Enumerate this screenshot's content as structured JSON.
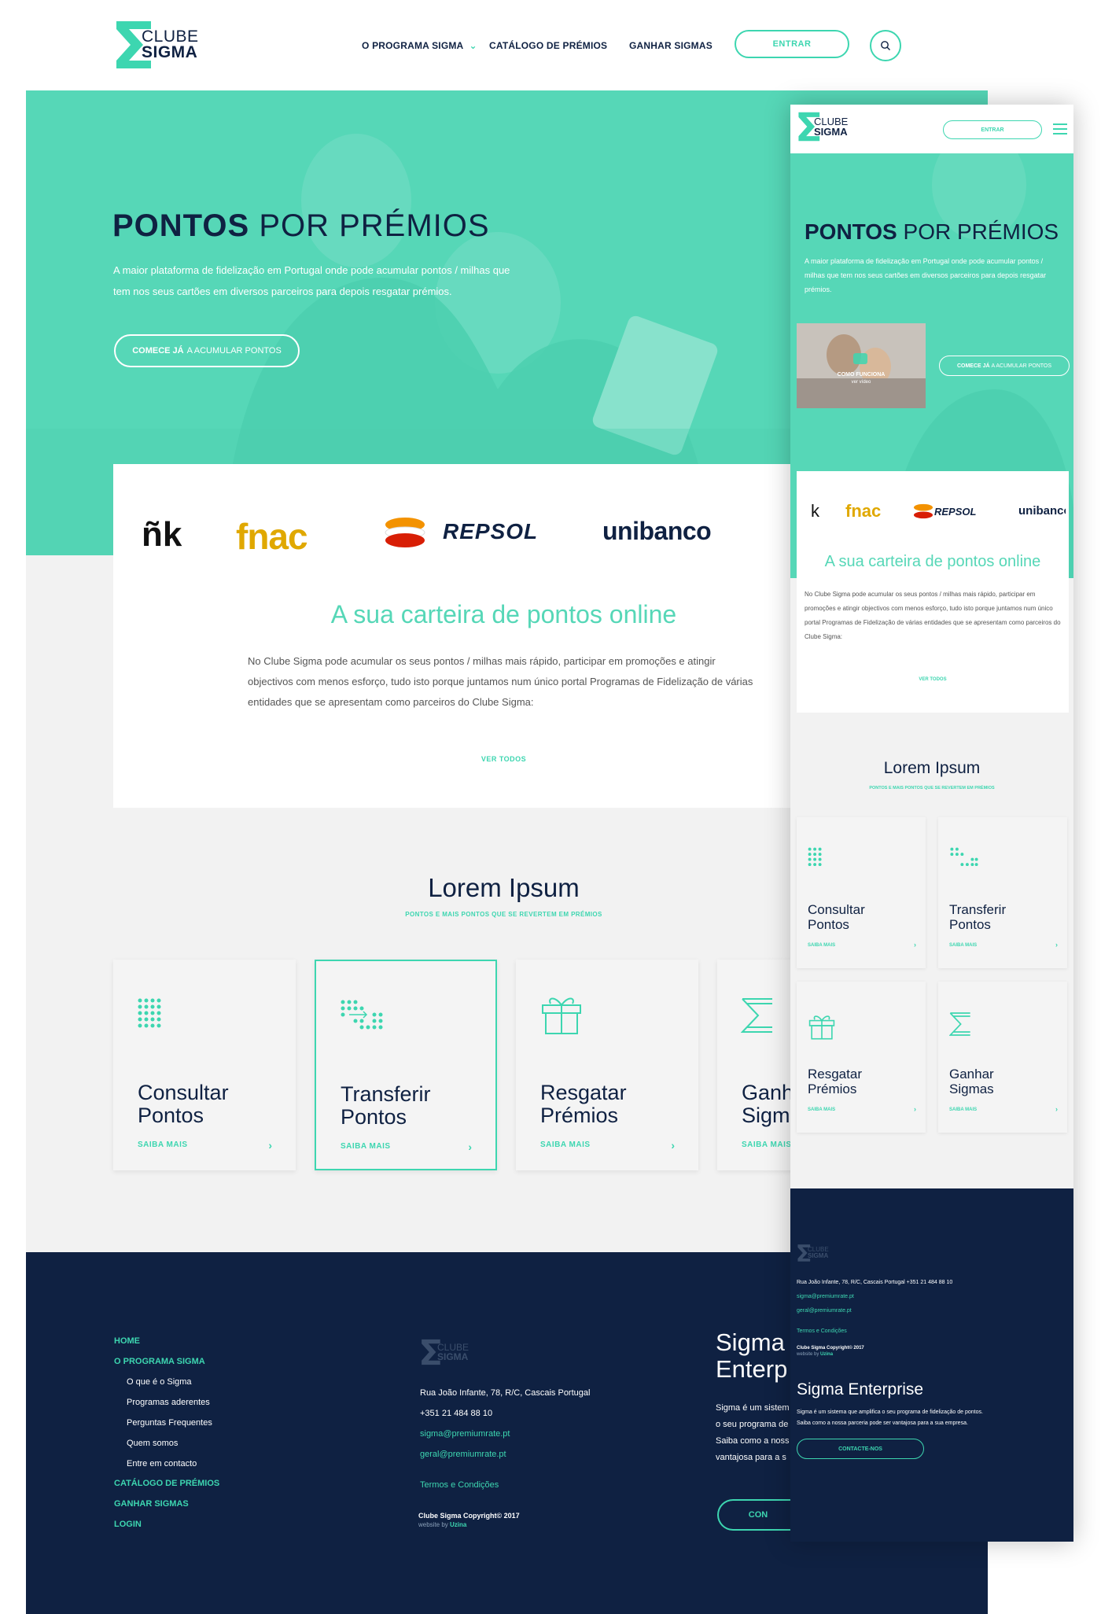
{
  "brand": {
    "line1": "CLUBE",
    "line2": "SIGMA"
  },
  "colors": {
    "mint": "#56d7b7",
    "accent": "#3dd6b0",
    "navy": "#0f2142",
    "light_gray": "#f2f2f2"
  },
  "nav": {
    "items": [
      "O PROGRAMA SIGMA",
      "CATÁLOGO DE PRÉMIOS",
      "GANHAR SIGMAS"
    ],
    "login": "ENTRAR",
    "search_icon": "search-icon"
  },
  "hero": {
    "title_bold": "PONTOS",
    "title_rest": "POR PRÉMIOS",
    "text": "A maior plataforma de fidelização em Portugal onde pode acumular pontos / milhas que tem nos seus cartões em diversos parceiros para depois resgatar prémios.",
    "cta_bold": "COMECE JÁ",
    "cta_rest": "A ACUMULAR PONTOS"
  },
  "partners": [
    "ñk",
    "fnac",
    "REPSOL",
    "unibanco"
  ],
  "wallet": {
    "title": "A sua carteira de pontos online",
    "text": "No Clube Sigma pode acumular os seus pontos / milhas mais rápido, participar em promoções e atingir objectivos com menos esforço, tudo isto porque juntamos num único portal Programas de Fidelização de várias entidades que se apresentam como parceiros do Clube Sigma:",
    "link": "VER TODOS"
  },
  "features": {
    "title": "Lorem Ipsum",
    "subtitle": "PONTOS E MAIS PONTOS QUE SE REVERTEM EM PRÉMIOS",
    "cards": [
      {
        "line1": "Consultar",
        "line2": "Pontos",
        "link": "SAIBA MAIS",
        "icon": "dots-grid-icon"
      },
      {
        "line1": "Transferir",
        "line2": "Pontos",
        "link": "SAIBA MAIS",
        "icon": "dots-transfer-icon"
      },
      {
        "line1": "Resgatar",
        "line2": "Prémios",
        "link": "SAIBA MAIS",
        "icon": "gift-icon"
      },
      {
        "line1": "Ganhar",
        "line2": "Sigmas",
        "link": "SAIBA MAIS",
        "icon": "sigma-icon"
      }
    ]
  },
  "footer": {
    "menu": [
      "HOME",
      "O PROGRAMA SIGMA",
      "CATÁLOGO DE PRÉMIOS",
      "GANHAR SIGMAS",
      "LOGIN"
    ],
    "submenu": [
      "O que é o Sigma",
      "Programas aderentes",
      "Perguntas Frequentes",
      "Quem somos",
      "Entre em contacto"
    ],
    "address": "Rua João Infante, 78, R/C, Cascais Portugal",
    "phone": "+351 21 484 88 10",
    "email1": "sigma@premiumrate.pt",
    "email2": "geral@premiumrate.pt",
    "terms": "Termos e Condições",
    "copyright": "Clube Sigma Copyright© 2017",
    "website_by": "website by",
    "agency": "Uzina",
    "enterprise_title": "Sigma Enterprise",
    "enterprise_title_cut1": "Sigma",
    "enterprise_title_cut2": "Enterp",
    "enterprise_text_lines": [
      "Sigma é um sistem",
      "o seu programa de",
      "Saiba como a noss",
      "vantajosa para a s"
    ],
    "enterprise_btn_cut": "CON",
    "enterprise_text_full_1": "Sigma é um sistema que amplifica o seu programa de fidelização de pontos.",
    "enterprise_text_full_2": "Saiba como a nossa parceria pode ser vantajosa para a sua empresa.",
    "contact_btn": "CONTACTE-NOS"
  },
  "mobile": {
    "address_line": "Rua João Infante, 78, R/C, Cascais Portugal +351 21 484 88 10",
    "video_label1": "COMO FUNCIONA",
    "video_label2": "ver vídeo",
    "hero_text": "A maior plataforma de fidelização em Portugal onde pode acumular pontos / milhas que tem nos seus cartões em diversos parceiros para depois resgatar prémios."
  }
}
